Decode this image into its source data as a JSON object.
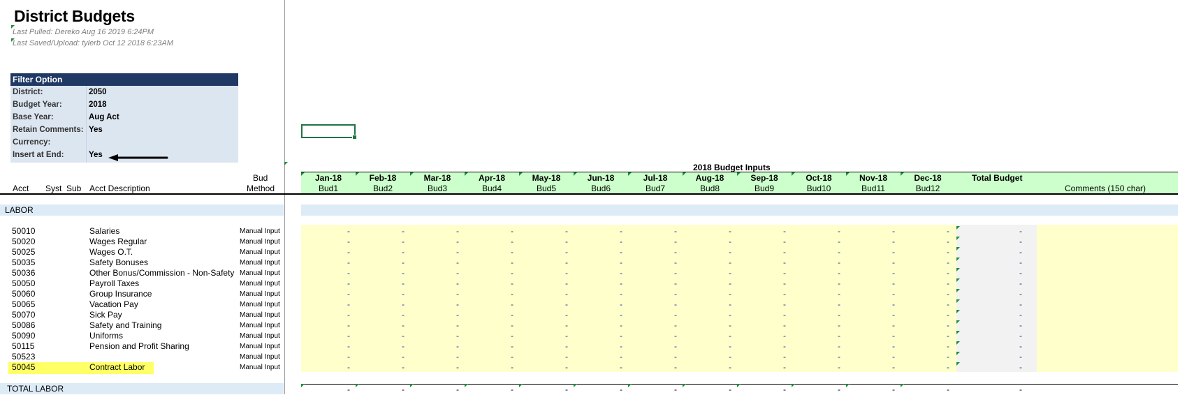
{
  "sheet": {
    "title": "District Budgets",
    "last_pulled": "Last Pulled: Dereko Aug 16 2019 6:24PM",
    "last_saved": "Last Saved/Upload: tylerb Oct 12 2018 6:23AM"
  },
  "filter": {
    "header": "Filter Option",
    "rows": [
      {
        "label": "District:",
        "value": "2050"
      },
      {
        "label": "Budget Year:",
        "value": "2018"
      },
      {
        "label": "Base Year:",
        "value": "Aug Act"
      },
      {
        "label": "Retain Comments:",
        "value": "Yes"
      },
      {
        "label": "Currency:",
        "value": ""
      },
      {
        "label": "Insert at End:",
        "value": "Yes"
      }
    ]
  },
  "columns": {
    "acct": "Acct",
    "syst": "Syst",
    "sub": "Sub",
    "desc": "Acct Description",
    "bud_line1": "Bud",
    "bud_line2": "Method",
    "group_title": "2018 Budget Inputs",
    "months": [
      {
        "m": "Jan-18",
        "b": "Bud1"
      },
      {
        "m": "Feb-18",
        "b": "Bud2"
      },
      {
        "m": "Mar-18",
        "b": "Bud3"
      },
      {
        "m": "Apr-18",
        "b": "Bud4"
      },
      {
        "m": "May-18",
        "b": "Bud5"
      },
      {
        "m": "Jun-18",
        "b": "Bud6"
      },
      {
        "m": "Jul-18",
        "b": "Bud7"
      },
      {
        "m": "Aug-18",
        "b": "Bud8"
      },
      {
        "m": "Sep-18",
        "b": "Bud9"
      },
      {
        "m": "Oct-18",
        "b": "Bud10"
      },
      {
        "m": "Nov-18",
        "b": "Bud11"
      },
      {
        "m": "Dec-18",
        "b": "Bud12"
      }
    ],
    "total": "Total Budget",
    "comments": "Comments (150 char)"
  },
  "section": "LABOR",
  "rows": [
    {
      "acct": "50010",
      "desc": "Salaries",
      "method": "Manual Input"
    },
    {
      "acct": "50020",
      "desc": "Wages Regular",
      "method": "Manual Input"
    },
    {
      "acct": "50025",
      "desc": "Wages O.T.",
      "method": "Manual Input"
    },
    {
      "acct": "50035",
      "desc": "Safety Bonuses",
      "method": "Manual Input"
    },
    {
      "acct": "50036",
      "desc": "Other Bonus/Commission - Non-Safety",
      "method": "Manual Input"
    },
    {
      "acct": "50050",
      "desc": "Payroll Taxes",
      "method": "Manual Input"
    },
    {
      "acct": "50060",
      "desc": "Group Insurance",
      "method": "Manual Input"
    },
    {
      "acct": "50065",
      "desc": "Vacation Pay",
      "method": "Manual Input"
    },
    {
      "acct": "50070",
      "desc": "Sick Pay",
      "method": "Manual Input"
    },
    {
      "acct": "50086",
      "desc": "Safety and Training",
      "method": "Manual Input"
    },
    {
      "acct": "50090",
      "desc": "Uniforms",
      "method": "Manual Input"
    },
    {
      "acct": "50115",
      "desc": "Pension and Profit Sharing",
      "method": "Manual Input"
    },
    {
      "acct": "50523",
      "desc": "",
      "method": "Manual Input"
    },
    {
      "acct": "50045",
      "desc": "Contract Labor",
      "method": "Manual Input",
      "highlight": true
    }
  ],
  "dash": "-",
  "total_label": "TOTAL LABOR",
  "colors": {
    "filter_header": "#1f3864",
    "filter_body": "#dce6f1",
    "header_band": "#ccffcc",
    "input_fill": "#ffffcc",
    "total_fill": "#f2f2f2",
    "highlight": "#ffff66",
    "section": "#ddebf7"
  }
}
